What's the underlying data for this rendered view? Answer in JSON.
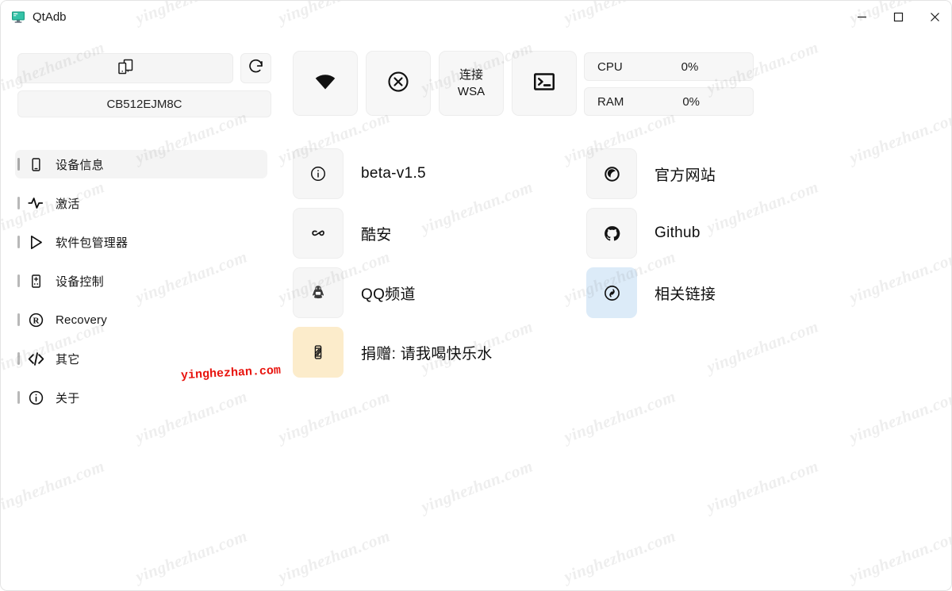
{
  "window": {
    "title": "QtAdb",
    "app_icon": "monitor-icon",
    "accent_teal": "#21b396",
    "controls": [
      {
        "name": "minimize",
        "glyph": "–"
      },
      {
        "name": "maximize",
        "glyph": "□"
      },
      {
        "name": "close",
        "glyph": "✕"
      }
    ]
  },
  "watermark": {
    "text": "yinghezhan.com",
    "red_text": "yinghezhan.com",
    "color": "#e8140e"
  },
  "sidebar": {
    "device_combo": {
      "placeholder": "",
      "value": "",
      "icon": "devices-icon"
    },
    "refresh": {
      "icon": "refresh-icon",
      "label": ""
    },
    "device_serial": "CB512EJM8C",
    "items": [
      {
        "label": "设备信息",
        "icon": "phone-icon",
        "active": true
      },
      {
        "label": "激活",
        "icon": "activity-pulse-icon",
        "active": false
      },
      {
        "label": "软件包管理器",
        "icon": "play-store-icon",
        "active": false
      },
      {
        "label": "设备控制",
        "icon": "gamepad-remote-icon",
        "active": false
      },
      {
        "label": "Recovery",
        "icon": "registered-r-icon",
        "active": false
      },
      {
        "label": "其它",
        "icon": "code-brackets-icon",
        "active": false
      },
      {
        "label": "关于",
        "icon": "info-circle-icon",
        "active": false
      }
    ]
  },
  "toolbar": {
    "buttons": [
      {
        "name": "wifi-connect-button",
        "icon": "wifi-icon",
        "label": ""
      },
      {
        "name": "disconnect-button",
        "icon": "circle-x-icon",
        "label": ""
      },
      {
        "name": "connect-wsa-button",
        "icon": "",
        "label_line1": "连接",
        "label_line2": "WSA"
      },
      {
        "name": "terminal-button",
        "icon": "terminal-icon",
        "label": ""
      }
    ]
  },
  "stats": [
    {
      "label": "CPU",
      "value": "0%"
    },
    {
      "label": "RAM",
      "value": "0%"
    }
  ],
  "cards_mid": [
    {
      "label": "beta-v1.5",
      "icon": "info-circle-icon",
      "tone": "plain"
    },
    {
      "label": "酷安",
      "icon": "coolapk-icon",
      "tone": "plain"
    },
    {
      "label": "QQ频道",
      "icon": "qq-penguin-icon",
      "tone": "plain"
    },
    {
      "label": "捐赠: 请我喝快乐水",
      "icon": "soda-can-icon",
      "tone": "amber"
    }
  ],
  "cards_right": [
    {
      "label": "官方网站",
      "icon": "website-globe-icon",
      "tone": "plain"
    },
    {
      "label": "Github",
      "icon": "github-icon",
      "tone": "plain"
    },
    {
      "label": "相关链接",
      "icon": "link-chain-icon",
      "tone": "blue"
    }
  ]
}
